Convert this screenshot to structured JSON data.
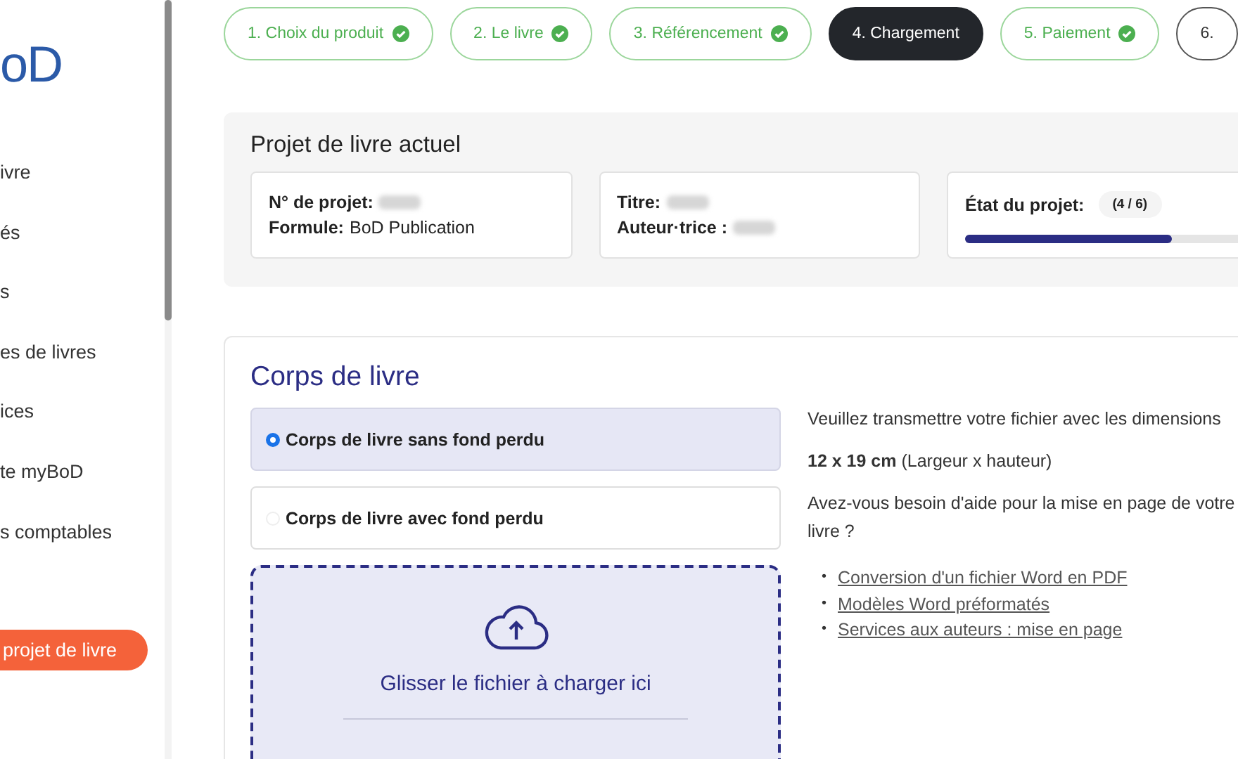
{
  "sidebar": {
    "logo": "oD",
    "items": [
      {
        "label": "ivre"
      },
      {
        "label": "és"
      },
      {
        "label": "s"
      },
      {
        "label": "es de livres"
      },
      {
        "label": "ices"
      },
      {
        "label": "te myBoD"
      },
      {
        "label": "s comptables"
      }
    ],
    "new_project_button": "projet de livre"
  },
  "steps": [
    {
      "label": "1. Choix du produit",
      "completed": true,
      "selected": false
    },
    {
      "label": "2. Le livre",
      "completed": true,
      "selected": false
    },
    {
      "label": "3. Référencement",
      "completed": true,
      "selected": false
    },
    {
      "label": "4. Chargement",
      "completed": false,
      "selected": true
    },
    {
      "label": "5. Paiement",
      "completed": true,
      "selected": false
    },
    {
      "label": "6.",
      "completed": false,
      "selected": false
    }
  ],
  "current_project": {
    "title": "Projet de livre actuel",
    "cards": [
      {
        "kind": "fields",
        "fields": [
          {
            "label": "N° de projet:",
            "redacted": true
          },
          {
            "label": "Formule:",
            "value": "BoD Publication"
          }
        ]
      },
      {
        "kind": "fields",
        "fields": [
          {
            "label": "Titre:",
            "redacted": true
          },
          {
            "label": "Auteur·trice :",
            "redacted": true
          }
        ]
      },
      {
        "kind": "progress",
        "label": "État du projet:",
        "badge": "(4 / 6)",
        "level": 0.667
      }
    ]
  },
  "body_section": {
    "title": "Corps de livre",
    "options": [
      {
        "label": "Corps de livre sans fond perdu",
        "selected": true
      },
      {
        "label": "Corps de livre avec fond perdu",
        "selected": false
      }
    ],
    "dropzone": {
      "text": "Glisser le fichier à charger ici"
    },
    "info": {
      "paragraphs": [
        "Veuillez transmettre votre fichier avec les dimensions",
        "**12 x 19 cm** (Largeur x hauteur)",
        "Avez-vous besoin d'aide pour la mise en page de votre livre ?"
      ],
      "links": [
        {
          "bullet": "•",
          "label": "Conversion d'un fichier Word en PDF"
        },
        {
          "bullet": "•",
          "label": "Modèles Word préformatés"
        },
        {
          "bullet": "•",
          "label": "Services aux auteurs : mise en page"
        }
      ]
    }
  }
}
